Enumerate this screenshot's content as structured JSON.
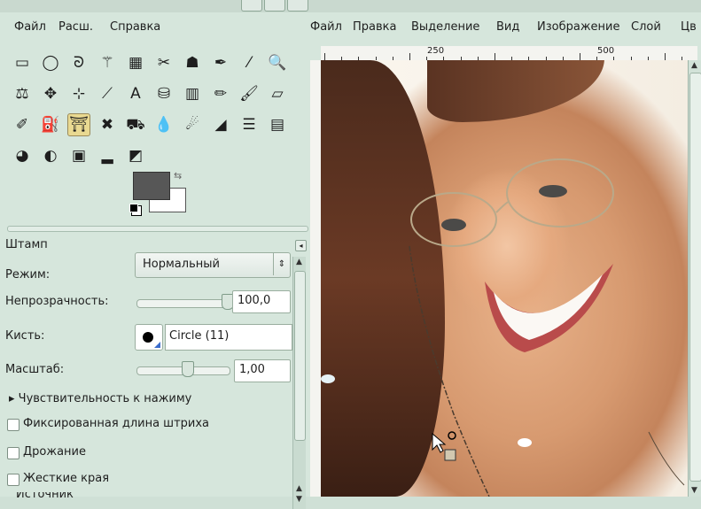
{
  "toolbox": {
    "menu": [
      {
        "label": "Файл"
      },
      {
        "label": "Расш."
      },
      {
        "label": "Справка"
      }
    ],
    "tools": [
      {
        "icon": "rect-select-icon",
        "glyph": "▭"
      },
      {
        "icon": "ellipse-select-icon",
        "glyph": "◯"
      },
      {
        "icon": "lasso-icon",
        "glyph": "ᘐ"
      },
      {
        "icon": "fuzzy-select-icon",
        "glyph": "⚚"
      },
      {
        "icon": "color-select-icon",
        "glyph": "▦"
      },
      {
        "icon": "scissors-icon",
        "glyph": "✂"
      },
      {
        "icon": "foreground-select-icon",
        "glyph": "☗"
      },
      {
        "icon": "paths-icon",
        "glyph": "✒"
      },
      {
        "icon": "color-picker-icon",
        "glyph": "⁄"
      },
      {
        "icon": "zoom-icon",
        "glyph": "🔍"
      },
      {
        "icon": "measure-icon",
        "glyph": "⚖"
      },
      {
        "icon": "move-icon",
        "glyph": "✥"
      },
      {
        "icon": "align-icon",
        "glyph": "⊹"
      },
      {
        "icon": "crop-icon",
        "glyph": "⟋"
      },
      {
        "icon": "text-icon",
        "glyph": "A"
      },
      {
        "icon": "bucket-fill-icon",
        "glyph": "⛁"
      },
      {
        "icon": "blend-icon",
        "glyph": "▥"
      },
      {
        "icon": "pencil-icon",
        "glyph": "✏"
      },
      {
        "icon": "paintbrush-icon",
        "glyph": "🖌"
      },
      {
        "icon": "eraser-icon",
        "glyph": "▱"
      },
      {
        "icon": "airbrush-icon",
        "glyph": "✐"
      },
      {
        "icon": "ink-icon",
        "glyph": "⛽"
      },
      {
        "icon": "clone-icon",
        "glyph": "⛩",
        "active": true
      },
      {
        "icon": "heal-icon",
        "glyph": "✖"
      },
      {
        "icon": "perspective-clone-icon",
        "glyph": "⛟"
      },
      {
        "icon": "blur-icon",
        "glyph": "💧"
      },
      {
        "icon": "smudge-icon",
        "glyph": "☄"
      },
      {
        "icon": "dodge-burn-icon",
        "glyph": "◢"
      },
      {
        "icon": "levels-icon",
        "glyph": "☰"
      },
      {
        "icon": "curves-icon",
        "glyph": "▤"
      },
      {
        "icon": "color-balance-icon",
        "glyph": "◕"
      },
      {
        "icon": "hue-icon",
        "glyph": "◐"
      },
      {
        "icon": "screenshot-icon",
        "glyph": "▣"
      },
      {
        "icon": "histogram-icon",
        "glyph": "▂"
      },
      {
        "icon": "tone-icon",
        "glyph": "◩"
      }
    ],
    "colors": {
      "foreground": "#575757",
      "background": "#ffffff"
    }
  },
  "tool_options": {
    "title": "Штамп",
    "mode_label": "Режим:",
    "mode_value": "Нормальный",
    "opacity_label": "Непрозрачность:",
    "opacity_value": "100,0",
    "opacity_fraction": 1.0,
    "brush_label": "Кисть:",
    "brush_value": "Circle (11)",
    "scale_label": "Масштаб:",
    "scale_value": "1,00",
    "scale_fraction": 0.55,
    "pressure_label": "▸ Чувствительность к нажиму",
    "fixed_stroke_label": "Фиксированная длина штриха",
    "jitter_label": "Дрожание",
    "hard_edges_label": "Жесткие края",
    "source_label": "Источник"
  },
  "image_window": {
    "menu": [
      {
        "label": "Файл"
      },
      {
        "label": "Правка"
      },
      {
        "label": "Выделение"
      },
      {
        "label": "Вид"
      },
      {
        "label": "Изображение"
      },
      {
        "label": "Слой"
      },
      {
        "label": "Цв"
      }
    ],
    "ruler_labels": [
      "250",
      "500"
    ]
  }
}
